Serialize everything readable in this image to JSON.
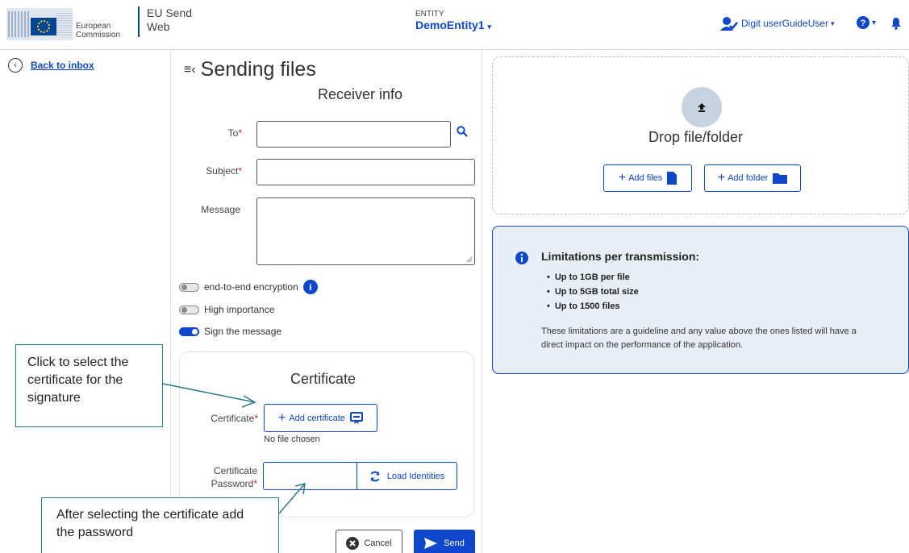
{
  "header": {
    "logo_line1": "European",
    "logo_line2": "Commission",
    "app_title_line1": "EU Send",
    "app_title_line2": "Web",
    "entity_label": "ENTITY",
    "entity_name": "DemoEntity1",
    "user_name": "Digit userGuideUser"
  },
  "nav": {
    "back_label": "Back to inbox"
  },
  "form": {
    "page_title": "Sending files",
    "receiver_section": "Receiver info",
    "to_label": "To",
    "subject_label": "Subject",
    "message_label": "Message",
    "required_mark": "*",
    "to_value": "",
    "subject_value": "",
    "message_value": "",
    "toggles": [
      {
        "label": "end-to-end encryption",
        "on": false
      },
      {
        "label": "High importance",
        "on": false
      },
      {
        "label": "Sign the message",
        "on": true
      }
    ],
    "certificate_section": "Certificate",
    "certificate_label": "Certificate",
    "add_certificate_label": "Add certificate",
    "no_file_text": "No file chosen",
    "password_label_line1": "Certificate",
    "password_label_line2": "Password",
    "load_identities_label": "Load Identities",
    "cancel_label": "Cancel",
    "send_label": "Send"
  },
  "upload": {
    "drop_title": "Drop file/folder",
    "add_files_label": "Add files",
    "add_folder_label": "Add folder"
  },
  "limits": {
    "title": "Limitations per transmission:",
    "items": [
      "Up to 1GB per file",
      "Up to 5GB total size",
      "Up to 1500 files"
    ],
    "note": "These limitations are a guideline and any value above the ones listed will have a direct impact on the performance of the application."
  },
  "callouts": {
    "certificate_hint": "Click to select the certificate for the signature",
    "password_hint": "After selecting the certificate add the password"
  },
  "colors": {
    "accent": "#0e47cb",
    "callout_border": "#2b7a8e",
    "required": "#d0212c"
  }
}
